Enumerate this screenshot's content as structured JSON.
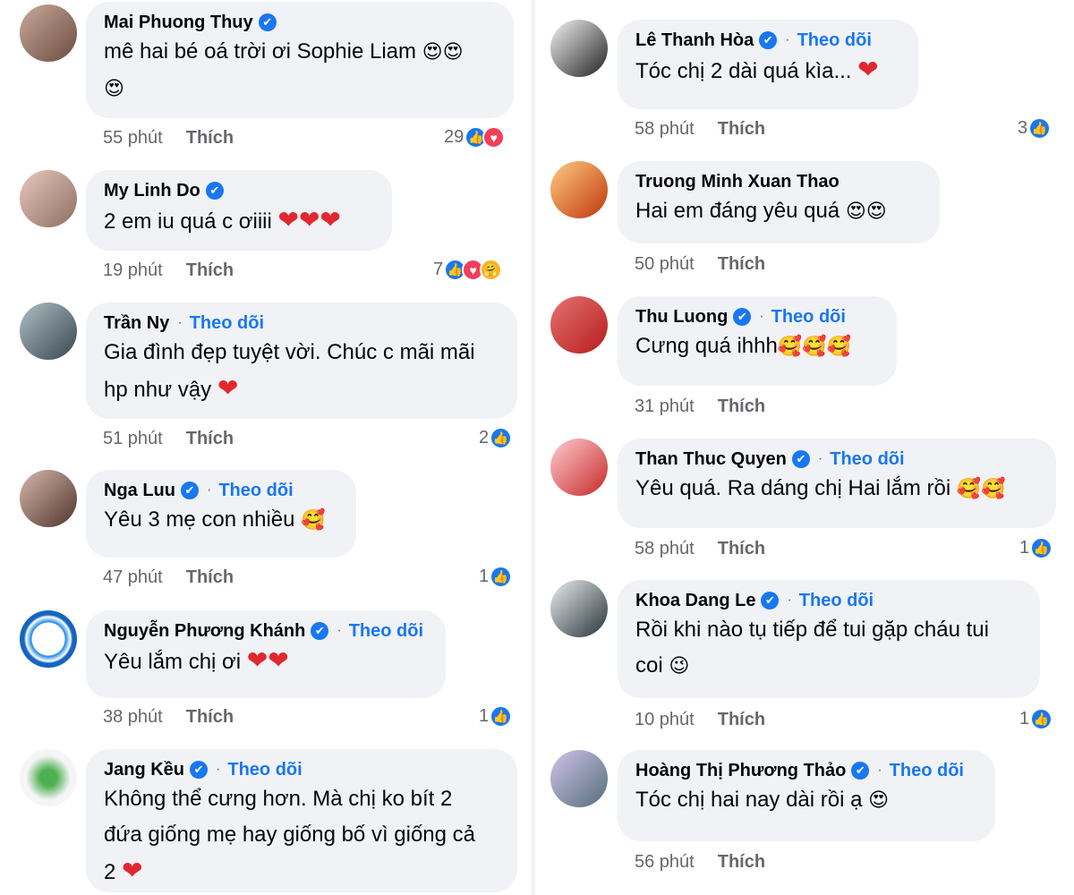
{
  "verified_icon": "✔",
  "like_label": "Thích",
  "follow_label": "Theo dõi",
  "colors": {
    "accent": "#1877f2",
    "bubble": "#f0f2f5",
    "muted": "#65676b",
    "love": "#f33e58"
  },
  "comments": [
    {
      "name": "Mai Phuong Thuy",
      "verified": true,
      "follow": false,
      "lines": [
        "mê hai bé oá trời ơi Sophie Liam 😍😍",
        "😍"
      ],
      "time": "55 phút",
      "reaction_count": "29",
      "reactions": [
        "like-icon",
        "love-icon"
      ]
    },
    {
      "name": "My Linh Do",
      "verified": true,
      "follow": false,
      "lines": [
        "2 em iu quá c ơiiii ❤️❤️❤️"
      ],
      "time": "19 phút",
      "reaction_count": "7",
      "reactions": [
        "like-icon",
        "love-icon",
        "care-icon"
      ]
    },
    {
      "name": "Trần Ny",
      "verified": false,
      "follow": true,
      "lines": [
        "Gia đình đẹp tuyệt vời. Chúc c mãi mãi",
        "hp như vậy ❤️"
      ],
      "time": "51 phút",
      "reaction_count": "2",
      "reactions": [
        "like-icon"
      ]
    },
    {
      "name": "Nga Luu",
      "verified": true,
      "follow": true,
      "lines": [
        "Yêu 3 mẹ con nhiều 🥰"
      ],
      "time": "47 phút",
      "reaction_count": "1",
      "reactions": [
        "like-icon"
      ]
    },
    {
      "name": "Nguyễn Phương Khánh",
      "verified": true,
      "follow": true,
      "lines": [
        "Yêu lắm chị ơi ❤️❤️"
      ],
      "time": "38 phút",
      "reaction_count": "1",
      "reactions": [
        "like-icon"
      ]
    },
    {
      "name": "Jang Kều",
      "verified": true,
      "follow": true,
      "lines": [
        "Không thể cưng hơn. Mà chị ko bít 2",
        "đứa giống mẹ hay giống bố vì giống cả",
        "2 ❤️"
      ],
      "time": "",
      "reaction_count": "",
      "reactions": []
    },
    {
      "name": "Lê Thanh Hòa",
      "verified": true,
      "follow": true,
      "lines": [
        "Tóc chị 2 dài quá kìa... ❤️"
      ],
      "time": "58 phút",
      "reaction_count": "3",
      "reactions": [
        "like-icon"
      ]
    },
    {
      "name": "Truong Minh Xuan Thao",
      "verified": false,
      "follow": false,
      "lines": [
        "Hai em đáng yêu quá 😍😍"
      ],
      "time": "50 phút",
      "reaction_count": "",
      "reactions": []
    },
    {
      "name": "Thu Luong",
      "verified": true,
      "follow": true,
      "lines": [
        "Cưng quá ihhh🥰🥰🥰"
      ],
      "time": "31 phút",
      "reaction_count": "",
      "reactions": []
    },
    {
      "name": "Than Thuc Quyen",
      "verified": true,
      "follow": true,
      "lines": [
        "Yêu quá. Ra dáng chị Hai lắm rồi 🥰🥰"
      ],
      "time": "58 phút",
      "reaction_count": "1",
      "reactions": [
        "like-icon"
      ]
    },
    {
      "name": "Khoa Dang Le",
      "verified": true,
      "follow": true,
      "lines": [
        "Rồi khi nào tụ tiếp để tui gặp cháu tui",
        "coi 😉"
      ],
      "time": "10 phút",
      "reaction_count": "1",
      "reactions": [
        "like-icon"
      ]
    },
    {
      "name": "Hoàng Thị Phương Thảo",
      "verified": true,
      "follow": true,
      "lines": [
        "Tóc chị hai nay dài rồi ạ 😍"
      ],
      "time": "56 phút",
      "reaction_count": "",
      "reactions": []
    }
  ]
}
